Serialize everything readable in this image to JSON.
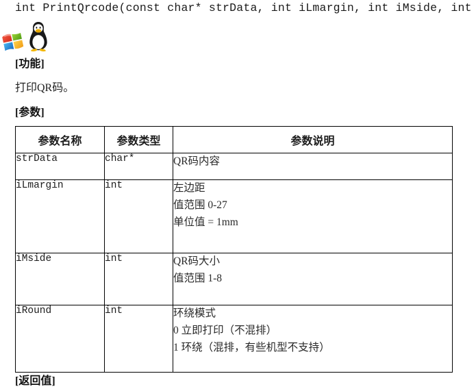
{
  "document": {
    "signature": "int PrintQrcode(const char* strData, int iLmargin, int iMside, int iRound)",
    "os_icons": [
      {
        "name": "windows-logo-icon",
        "label": "Windows"
      },
      {
        "name": "linux-tux-icon",
        "label": "Linux"
      }
    ],
    "sections": {
      "function_heading": "[功能]",
      "function_text": "打印QR码。",
      "params_heading": "[参数]",
      "return_heading": "[返回值]"
    },
    "table": {
      "headers": [
        "参数名称",
        "参数类型",
        "参数说明"
      ],
      "rows": [
        {
          "name": "strData",
          "type": "char*",
          "desc": [
            "QR码内容"
          ]
        },
        {
          "name": "iLmargin",
          "type": "int",
          "desc": [
            "左边距",
            "值范围 0-27",
            "单位值 = 1mm"
          ]
        },
        {
          "name": "iMside",
          "type": "int",
          "desc": [
            "QR码大小",
            "值范围 1-8"
          ]
        },
        {
          "name": "iRound",
          "type": "int",
          "desc": [
            "环绕模式",
            "0 立即打印（不混排）",
            "1 环绕（混排，有些机型不支持）"
          ]
        }
      ]
    },
    "colors": {
      "text": "#1a1a1a",
      "border": "#000000",
      "background": "#ffffff"
    }
  }
}
